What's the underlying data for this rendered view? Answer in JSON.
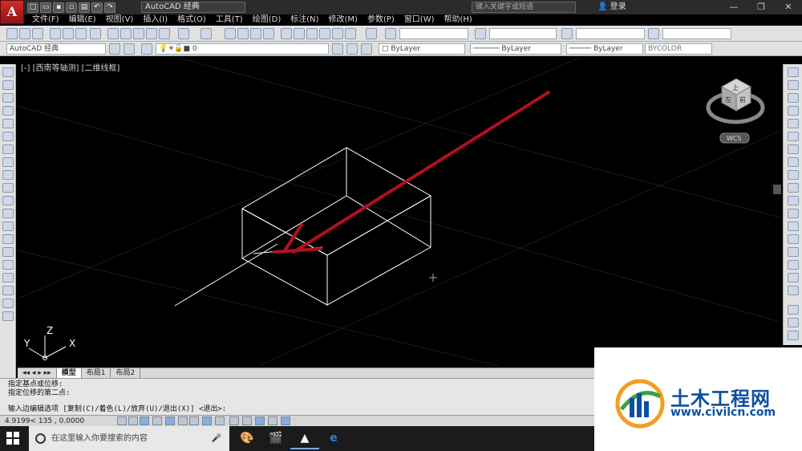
{
  "title_bar": {
    "workspace": "AutoCAD 经典",
    "search_placeholder": "键入关键字或短语",
    "login_label": "登录",
    "logo_letter": "A"
  },
  "menu": [
    "文件(F)",
    "编辑(E)",
    "视图(V)",
    "插入(I)",
    "格式(O)",
    "工具(T)",
    "绘图(D)",
    "标注(N)",
    "修改(M)",
    "参数(P)",
    "窗口(W)",
    "帮助(H)"
  ],
  "toolbar2": {
    "workspace_combo": "AutoCAD 经典",
    "layer_combo": "0",
    "color_combo": "ByLayer",
    "linetype_combo": "ByLayer",
    "lineweight_combo": "ByLayer",
    "plotstyle_combo": "BYCOLOR"
  },
  "viewport": {
    "label": "[-] [西南等轴测] [二维线框]",
    "wcs_label": "WCS",
    "viewcube_top": "上",
    "viewcube_front": "前",
    "viewcube_left": "左",
    "ucs_x": "X",
    "ucs_y": "Y",
    "ucs_z": "Z",
    "annotation_color": "#b01020",
    "wire_color": "#ffffff"
  },
  "layout_tabs": [
    "模型",
    "布局1",
    "布局2"
  ],
  "active_tab": "模型",
  "command_lines": [
    "指定基点或位移:",
    "指定位移的第二点:",
    "输入边编辑选项 [复制(C)/着色(L)/放弃(U)/退出(X)] <退出>:"
  ],
  "status": {
    "coords": "4.9199<  135  ,  0.0000"
  },
  "taskbar": {
    "search_text": "在这里输入你要搜索的内容"
  },
  "watermark": {
    "title": "土木工程网",
    "url": "www.civilcn.com"
  }
}
